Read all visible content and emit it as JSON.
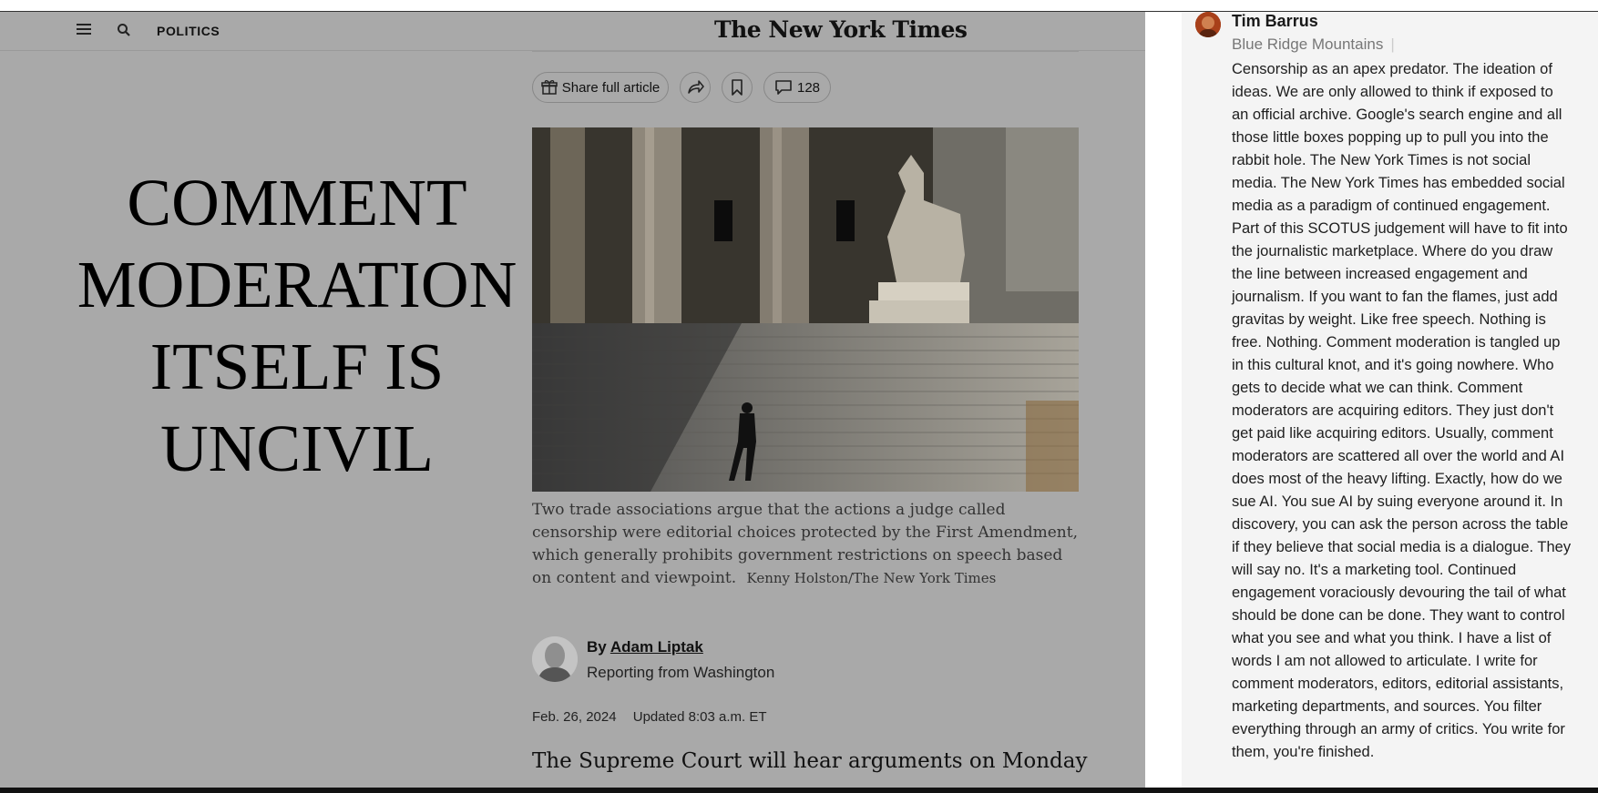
{
  "header": {
    "section_label": "POLITICS",
    "masthead": "The New York Times"
  },
  "actions": {
    "share_label": "Share full article",
    "comment_count": "128"
  },
  "overlay": {
    "lines": [
      "COMMENT",
      "MODERATION",
      "ITSELF IS",
      "UNCIVIL"
    ]
  },
  "caption": {
    "text": "Two trade associations argue that the actions a judge called censorship were editorial choices protected by the First Amendment, which generally prohibits government restrictions on speech based on content and viewpoint.",
    "credit": "Kenny Holston/The New York Times"
  },
  "byline": {
    "prefix": "By",
    "author": "Adam Liptak",
    "reporting": "Reporting from Washington"
  },
  "dates": {
    "published": "Feb. 26, 2024",
    "updated": "Updated 8:03 a.m. ET"
  },
  "lead": "The Supreme Court will hear arguments on Monday",
  "comment": {
    "author": "Tim Barrus",
    "location": "Blue Ridge Mountains",
    "separator": "|",
    "text": "Censorship as an apex predator. The ideation of ideas. We are only allowed to think if exposed to an official archive. Google's search engine and all those little boxes popping up to pull you into the rabbit hole. The New York Times is not social media. The New York Times has embedded social media as a paradigm of continued engagement. Part of this SCOTUS judgement will have to fit into the journalistic marketplace. Where do you draw the line between increased engagement and journalism. If you want to fan the flames, just add gravitas by weight. Like free speech. Nothing is free. Nothing. Comment moderation is tangled up in this cultural knot, and it's going nowhere. Who gets to decide what we can think. Comment moderators are acquiring editors. They just don't get paid like acquiring editors. Usually, comment moderators are scattered all over the world and AI does most of the heavy lifting. Exactly, how do we sue AI. You sue AI by suing everyone around it. In discovery, you can ask the person across the table if they believe that social media is a dialogue. They will say no. It's a marketing tool. Continued engagement voraciously devouring the tail of what should be done can be done. They want to control what you see and what you think. I have a list of words I am not allowed to articulate. I write for comment moderators, editors, editorial assistants, marketing departments, and sources. You filter everything through an army of critics. You write for them, you're finished."
  },
  "icons": {
    "menu": "menu-icon",
    "search": "search-icon",
    "gift": "gift-icon",
    "share": "share-arrow-icon",
    "bookmark": "bookmark-icon",
    "comment": "comment-bubble-icon"
  }
}
